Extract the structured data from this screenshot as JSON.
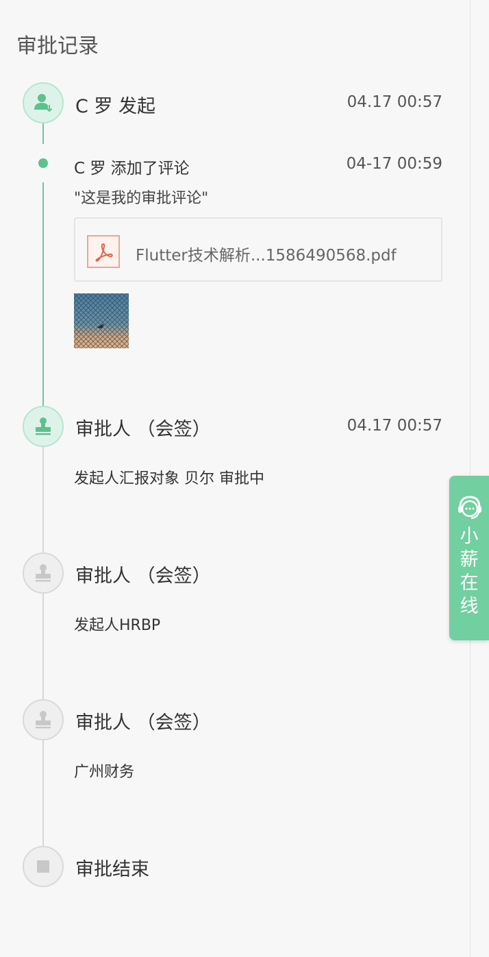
{
  "section": {
    "title": "审批记录"
  },
  "steps": [
    {
      "title": "C 罗 发起",
      "time": "04.17 00:57"
    },
    {
      "title": "审批人 （会签）",
      "time": "04.17 00:57",
      "sub": "发起人汇报对象  贝尔  审批中"
    },
    {
      "title": "审批人 （会签）",
      "sub": "发起人HRBP"
    },
    {
      "title": "审批人 （会签）",
      "sub": "广州财务"
    },
    {
      "title": "审批结束"
    }
  ],
  "comment": {
    "author_action": "C 罗 添加了评论",
    "time": "04-17 00:59",
    "text": "\"这是我的审批评论\"",
    "attachment": {
      "file_name": "Flutter技术解析...1586490568.pdf",
      "icon": "pdf-icon"
    },
    "image": {
      "icon": "photo-thumbnail"
    }
  },
  "floating_service": {
    "label_chars": [
      "小",
      "薪",
      "在",
      "线"
    ],
    "icon": "headset-chat-icon"
  },
  "colors": {
    "accent": "#5ec18c",
    "node_active_bg": "#ddf3e9",
    "node_inactive_bg": "#efefef",
    "float_bg": "#72cfa0"
  }
}
